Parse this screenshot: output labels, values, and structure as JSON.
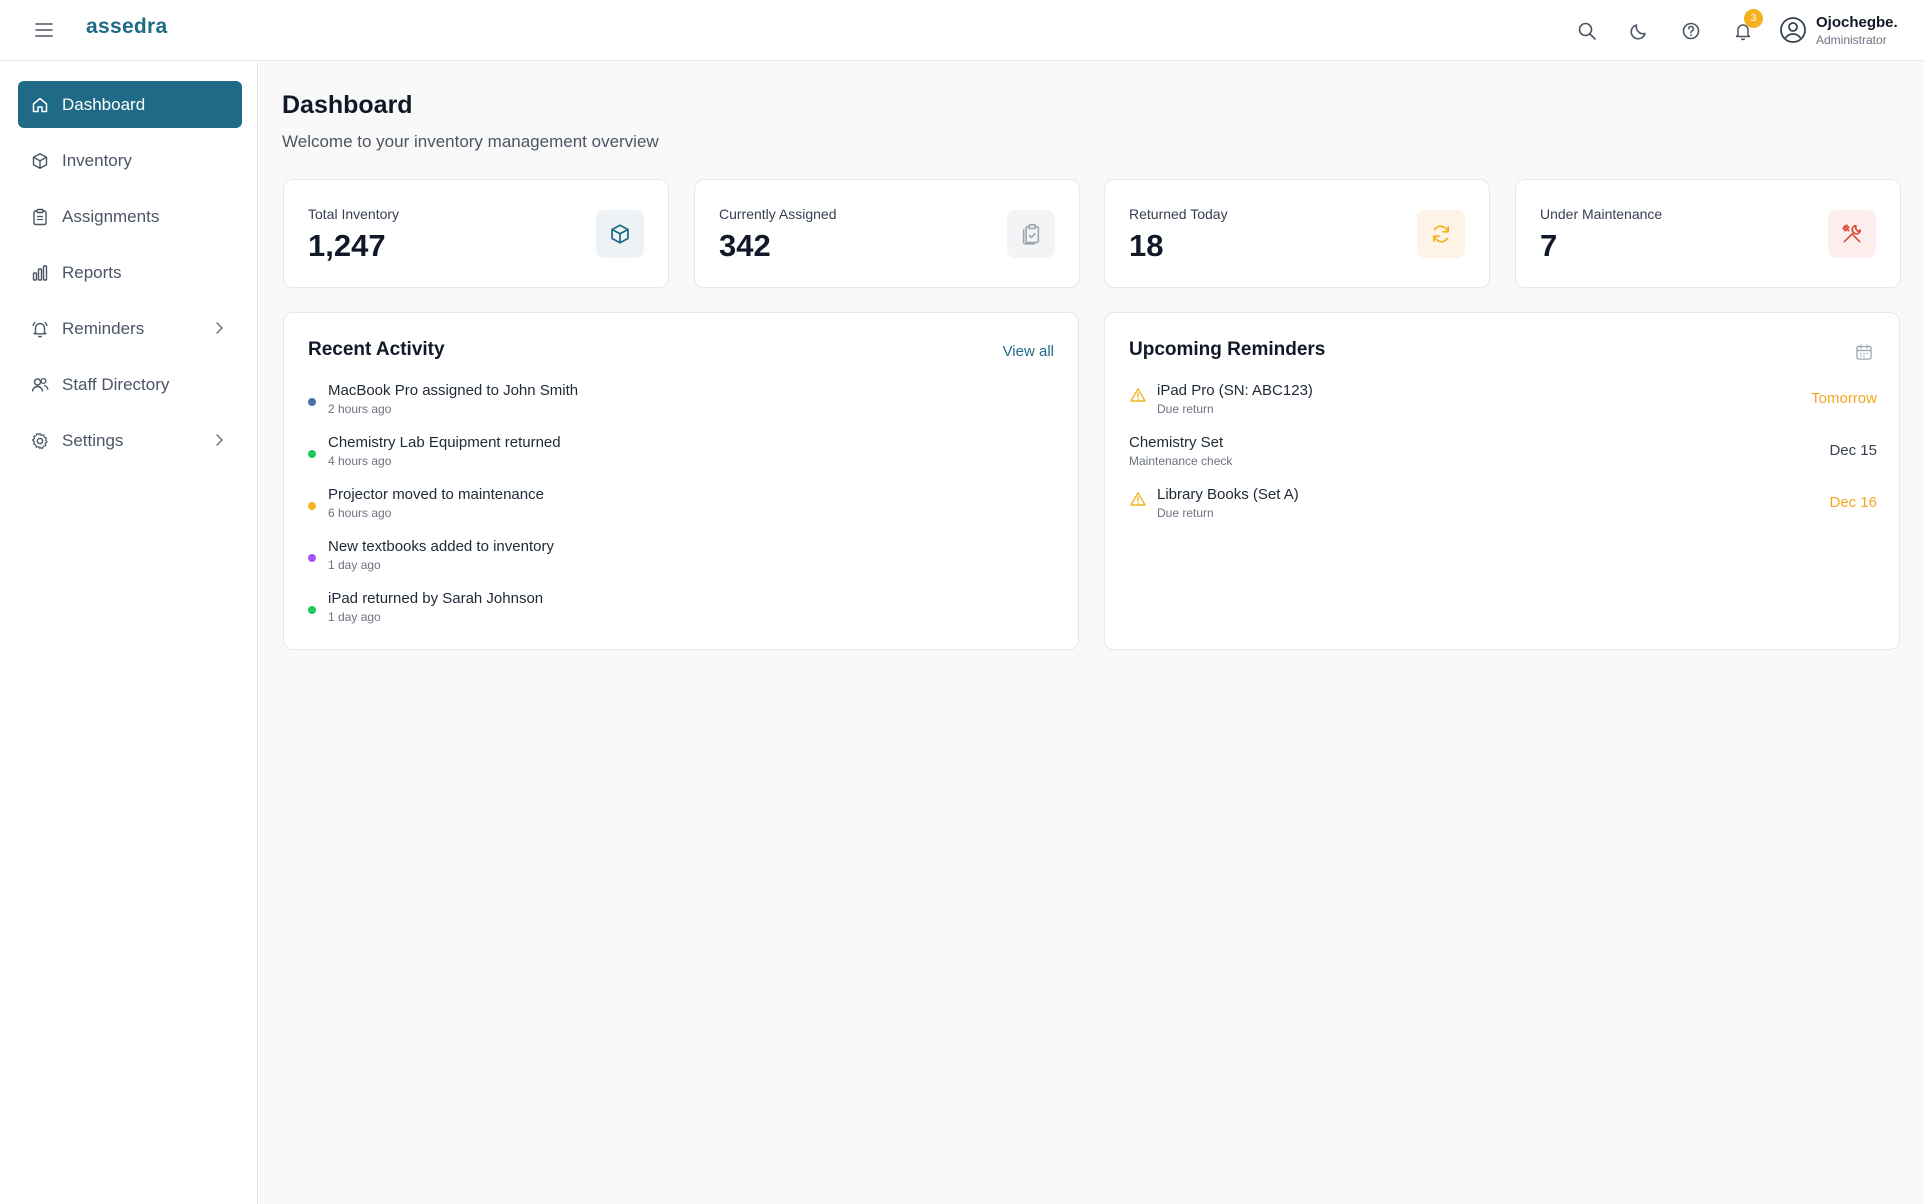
{
  "app": {
    "logo": "assedra"
  },
  "header": {
    "notification_count": "3",
    "user": {
      "name": "Ojochegbe.",
      "role": "Administrator"
    }
  },
  "sidebar": {
    "items": [
      {
        "label": "Dashboard",
        "icon": "home-icon",
        "active": true
      },
      {
        "label": "Inventory",
        "icon": "box-icon"
      },
      {
        "label": "Assignments",
        "icon": "clipboard-icon"
      },
      {
        "label": "Reports",
        "icon": "bar-chart-icon"
      },
      {
        "label": "Reminders",
        "icon": "bell-icon",
        "expandable": true
      },
      {
        "label": "Staff Directory",
        "icon": "users-icon"
      },
      {
        "label": "Settings",
        "icon": "gear-icon",
        "expandable": true
      }
    ]
  },
  "page": {
    "title": "Dashboard",
    "subtitle": "Welcome to your inventory management overview"
  },
  "stats": [
    {
      "label": "Total Inventory",
      "value": "1,247",
      "icon": "box-icon",
      "color": "#1e6a87",
      "bg": "#eef2f4"
    },
    {
      "label": "Currently Assigned",
      "value": "342",
      "icon": "clipboard-icon",
      "color": "#9ca3af",
      "bg": "#f3f4f6"
    },
    {
      "label": "Returned Today",
      "value": "18",
      "icon": "refresh-icon",
      "color": "#f5b11e",
      "bg": "#fdf3e7"
    },
    {
      "label": "Under Maintenance",
      "value": "7",
      "icon": "tools-icon",
      "color": "#dc4a3a",
      "bg": "#fbeeec"
    }
  ],
  "recent_activity": {
    "title": "Recent Activity",
    "view_all": "View all",
    "items": [
      {
        "text": "MacBook Pro assigned to John Smith",
        "time": "2 hours ago",
        "color": "#4a6fa5"
      },
      {
        "text": "Chemistry Lab Equipment returned",
        "time": "4 hours ago",
        "color": "#22c55e"
      },
      {
        "text": "Projector moved to maintenance",
        "time": "6 hours ago",
        "color": "#f5b11e"
      },
      {
        "text": "New textbooks added to inventory",
        "time": "1 day ago",
        "color": "#a855f7"
      },
      {
        "text": "iPad returned by Sarah Johnson",
        "time": "1 day ago",
        "color": "#22c55e"
      }
    ]
  },
  "upcoming_reminders": {
    "title": "Upcoming Reminders",
    "items": [
      {
        "title": "iPad Pro (SN: ABC123)",
        "sub": "Due return",
        "date": "Tomorrow",
        "warning": true,
        "date_color": "#f5a623"
      },
      {
        "title": "Chemistry Set",
        "sub": "Maintenance check",
        "date": "Dec 15",
        "warning": false,
        "date_color": "#374151"
      },
      {
        "title": "Library Books (Set A)",
        "sub": "Due return",
        "date": "Dec 16",
        "warning": true,
        "date_color": "#f5a623"
      }
    ]
  }
}
